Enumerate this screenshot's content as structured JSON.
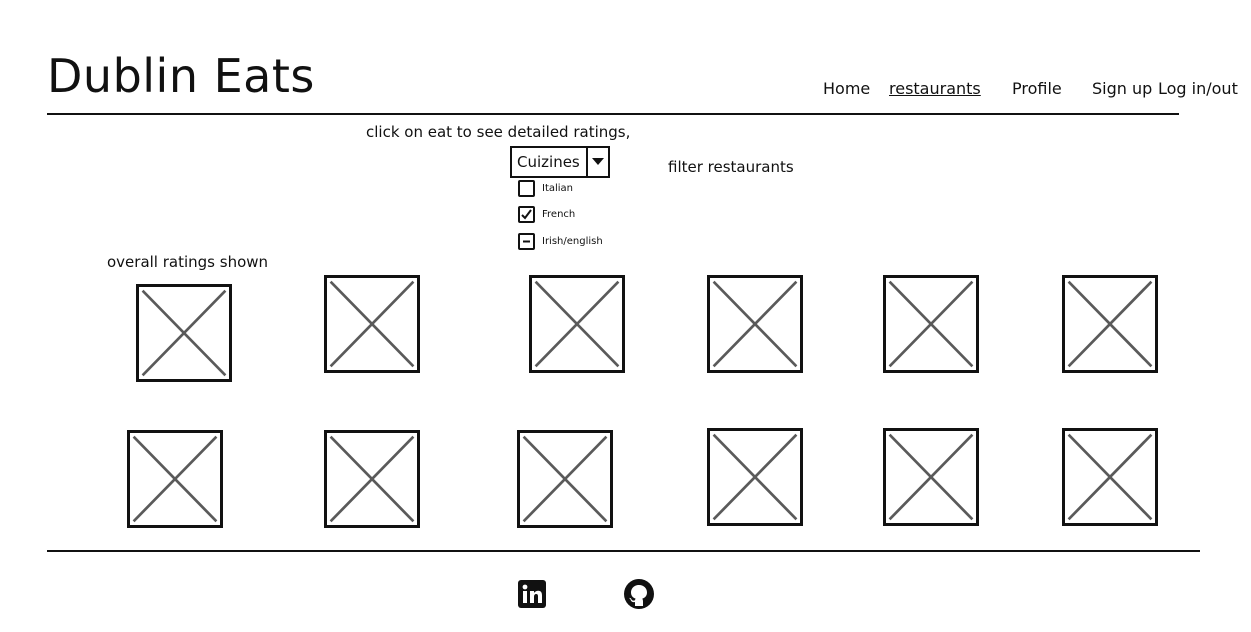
{
  "header": {
    "title": "Dublin Eats",
    "nav": {
      "home": "Home",
      "restaurants": "restaurants",
      "profile": "Profile",
      "signup": "Sign up",
      "login": "Log in/out"
    }
  },
  "main": {
    "instruction": "click on eat to see detailed ratings,",
    "filter_label": "filter restaurants",
    "overall_label": "overall ratings shown",
    "cuisine_select": {
      "value": "Cuizines",
      "options": [
        {
          "label": "Italian",
          "state": "unchecked"
        },
        {
          "label": "French",
          "state": "checked"
        },
        {
          "label": "Irish/english",
          "state": "indeterminate"
        }
      ]
    },
    "restaurant_count": 12
  },
  "footer": {
    "icons": [
      "linkedin-icon",
      "github-icon"
    ]
  },
  "colors": {
    "ink": "#111111",
    "placeholder_cross": "#5a5a5a",
    "background": "#ffffff"
  }
}
